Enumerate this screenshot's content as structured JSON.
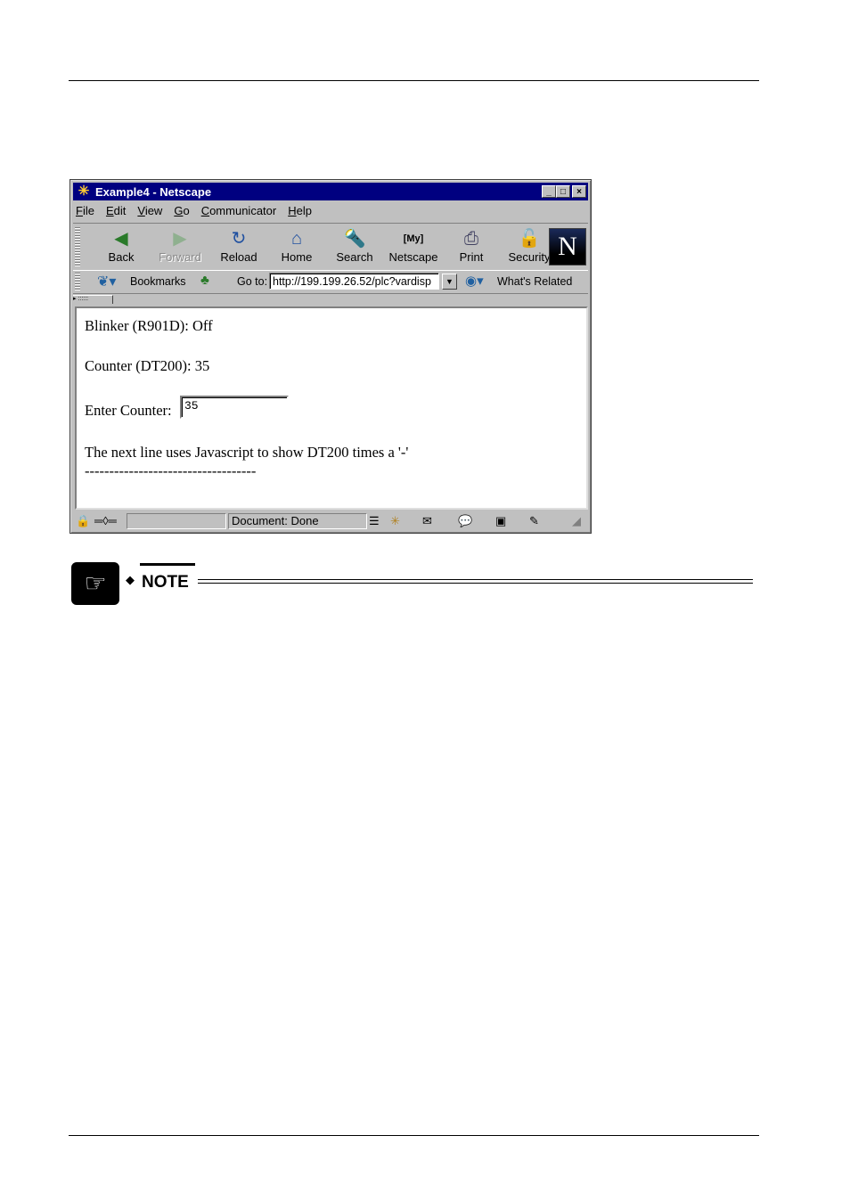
{
  "window": {
    "title": "Example4 - Netscape",
    "controls": [
      "_",
      "□",
      "×"
    ]
  },
  "menu": [
    "File",
    "Edit",
    "View",
    "Go",
    "Communicator",
    "Help"
  ],
  "toolbar": {
    "buttons": [
      {
        "label": "Back",
        "icon": "back-arrow-icon",
        "enabled": true
      },
      {
        "label": "Forward",
        "icon": "forward-arrow-icon",
        "enabled": false
      },
      {
        "label": "Reload",
        "icon": "reload-icon",
        "enabled": true
      },
      {
        "label": "Home",
        "icon": "home-icon",
        "enabled": true
      },
      {
        "label": "Search",
        "icon": "search-icon",
        "enabled": true
      },
      {
        "label": "Netscape",
        "icon": "my-netscape-icon",
        "enabled": true
      },
      {
        "label": "Print",
        "icon": "printer-icon",
        "enabled": true
      },
      {
        "label": "Security",
        "icon": "lock-icon",
        "enabled": true
      }
    ],
    "logo": "N"
  },
  "location": {
    "bookmarks_label": "Bookmarks",
    "goto_label": "Go to:",
    "url": "http://199.199.26.52/plc?vardisp",
    "related_label": "What's Related"
  },
  "page": {
    "blinker": "Blinker (R901D): Off",
    "counter": "Counter (DT200): 35",
    "enter_label": "Enter Counter:",
    "enter_value": "35",
    "js_note": "The next line uses Javascript to show DT200 times a '-'",
    "dashes": "-----------------------------------"
  },
  "status": {
    "text": "Document: Done"
  },
  "note": {
    "label": "NOTE"
  }
}
